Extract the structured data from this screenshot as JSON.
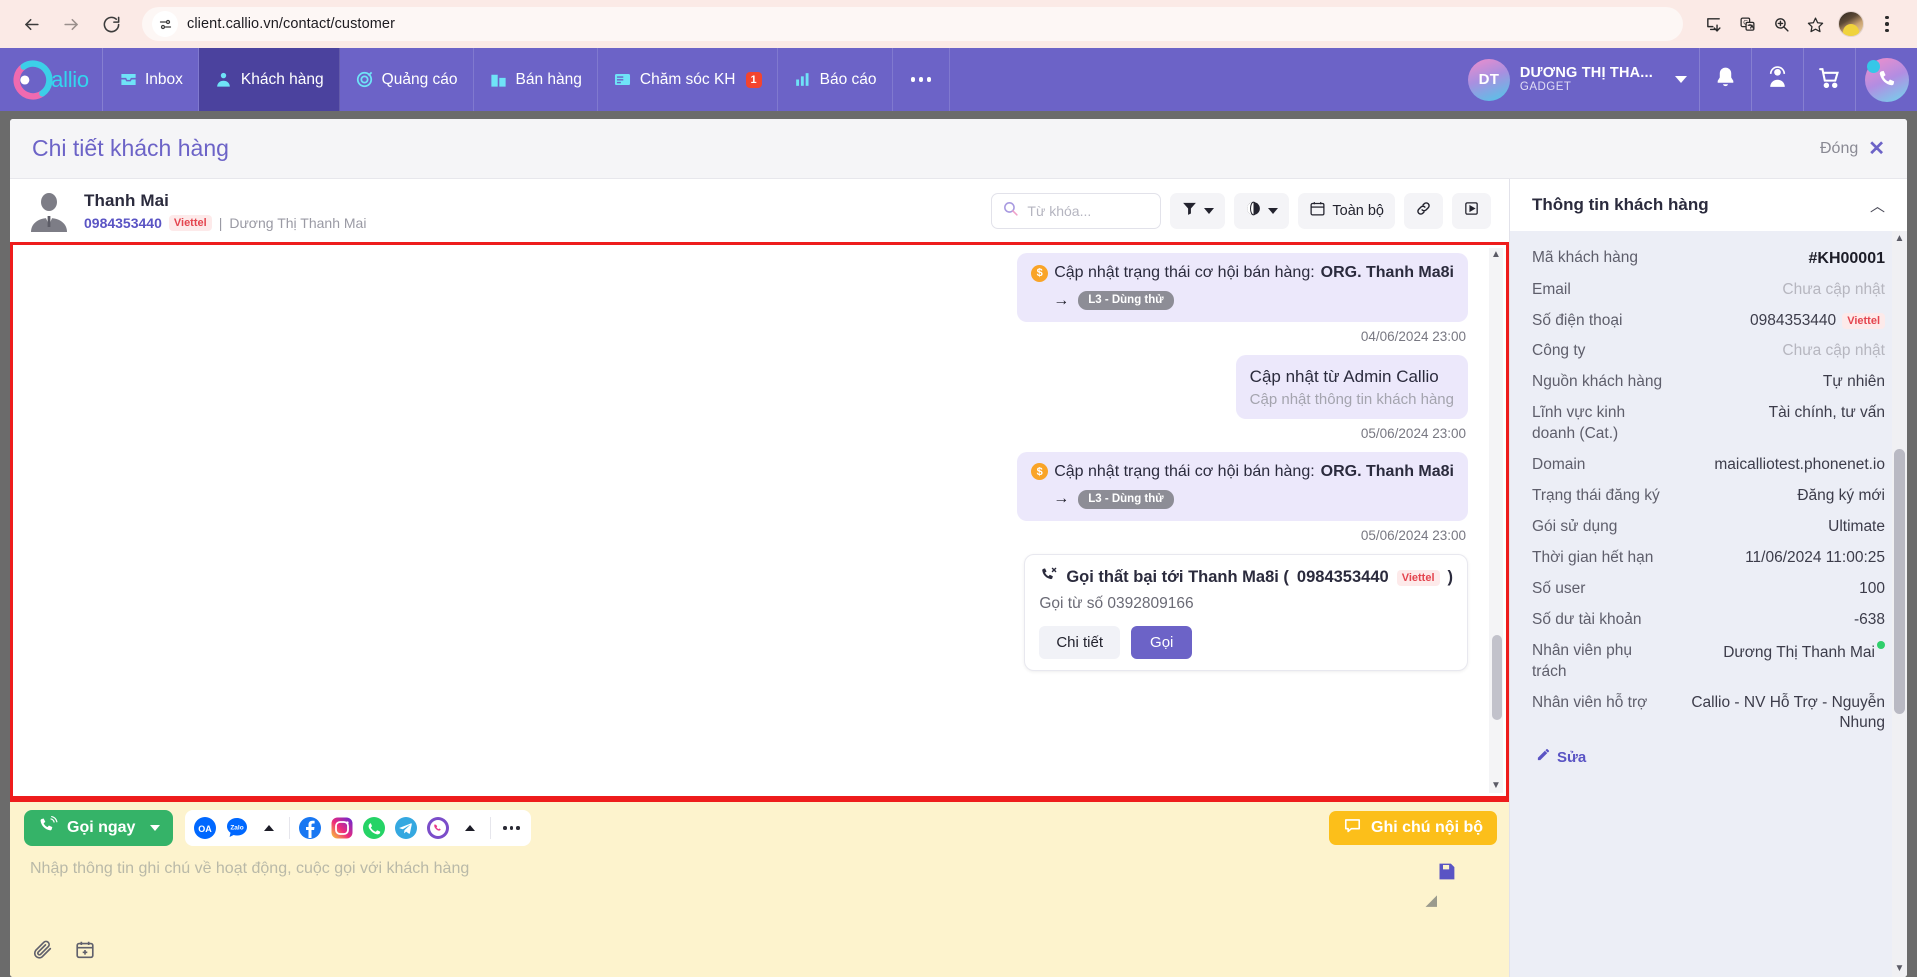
{
  "browser": {
    "url": "client.callio.vn/contact/customer",
    "icons": [
      "back-arrow-icon",
      "forward-arrow-icon",
      "reload-icon",
      "site-settings-icon",
      "install-icon",
      "translate-icon",
      "zoom-icon",
      "bookmark-star-icon",
      "profile-avatar",
      "kebab-menu-icon"
    ]
  },
  "app_header": {
    "brand": "allio",
    "nav": [
      {
        "label": "Inbox",
        "icon": "inbox-icon",
        "active": false,
        "badge": ""
      },
      {
        "label": "Khách hàng",
        "icon": "customers-icon",
        "active": true,
        "badge": ""
      },
      {
        "label": "Quảng cáo",
        "icon": "ads-target-icon",
        "active": false,
        "badge": ""
      },
      {
        "label": "Bán hàng",
        "icon": "sales-building-icon",
        "active": false,
        "badge": ""
      },
      {
        "label": "Chăm sóc KH",
        "icon": "support-ticket-icon",
        "active": false,
        "badge": "1"
      },
      {
        "label": "Báo cáo",
        "icon": "report-chart-icon",
        "active": false,
        "badge": ""
      }
    ],
    "more_label": "...",
    "user": {
      "initials": "DT",
      "name": "DƯƠNG THỊ THA...",
      "org": "GADGET"
    },
    "right_icons": [
      "bell-icon",
      "headset-agent-icon",
      "cart-icon",
      "phone-dialer-icon"
    ],
    "accent_color": "#6c63c7"
  },
  "panel": {
    "title": "Chi tiết khách hàng",
    "close_label": "Đóng",
    "close_x": "✕"
  },
  "contact": {
    "name": "Thanh Mai",
    "phone": "0984353440",
    "carrier": "Viettel",
    "separator": "|",
    "alias": "Dương Thị Thanh Mai"
  },
  "toolbar": {
    "search_placeholder": "Từ khóa...",
    "filter_icon": "funnel-filter-icon",
    "globe_icon": "globe-channel-icon",
    "date_label": "Toàn bộ",
    "date_icon": "calendar-icon",
    "link_icon": "link-chain-icon",
    "video_icon": "video-play-icon"
  },
  "timeline": [
    {
      "type": "deal",
      "icon": "coin-dollar-icon",
      "text": "Cập nhật trạng thái cơ hội bán hàng:",
      "strong": "ORG. Thanh Ma8i",
      "arrow": "→",
      "stage": "L3 - Dùng thử",
      "timestamp": "04/06/2024 23:00"
    },
    {
      "type": "info",
      "title": "Cập nhật từ Admin Callio",
      "subtitle": "Cập nhật thông tin khách hàng",
      "timestamp": "05/06/2024 23:00"
    },
    {
      "type": "deal",
      "icon": "coin-dollar-icon",
      "text": "Cập nhật trạng thái cơ hội bán hàng:",
      "strong": "ORG. Thanh Ma8i",
      "arrow": "→",
      "stage": "L3 - Dùng thử",
      "timestamp": "05/06/2024 23:00"
    },
    {
      "type": "call",
      "icon": "phone-missed-icon",
      "title_prefix": "Gọi thất bại tới Thanh Ma8i (",
      "phone": "0984353440",
      "carrier": "Viettel",
      "title_suffix": ")",
      "subtitle": "Gọi từ số 0392809166",
      "btn_detail": "Chi tiết",
      "btn_call": "Gọi"
    }
  ],
  "composer": {
    "call_now_label": "Gọi ngay",
    "call_now_icon": "phone-ring-icon",
    "channels": [
      "zalo-oa-icon",
      "zalo-icon",
      "up-caret-icon",
      "facebook-icon",
      "instagram-icon",
      "whatsapp-icon",
      "telegram-icon",
      "viber-icon",
      "up-caret-icon",
      "more-dots-icon"
    ],
    "note_label": "Ghi chú nội bộ",
    "note_icon": "chat-bubble-icon",
    "placeholder": "Nhập thông tin ghi chú về hoạt động, cuộc gọi với khách hàng",
    "attach_icon": "paperclip-icon",
    "schedule_icon": "calendar-plus-icon",
    "save_icon": "save-disk-icon"
  },
  "right_panel": {
    "title": "Thông tin khách hàng",
    "collapse_icon": "chevron-up-icon",
    "rows": [
      {
        "key": "Mã khách hàng",
        "value": "#KH00001",
        "style": "code"
      },
      {
        "key": "Email",
        "value": "Chưa cập nhật",
        "style": "muted"
      },
      {
        "key": "Số điện thoại",
        "value": "0984353440",
        "carrier": "Viettel",
        "style": "normal"
      },
      {
        "key": "Công ty",
        "value": "Chưa cập nhật",
        "style": "muted"
      },
      {
        "key": "Nguồn khách hàng",
        "value": "Tự nhiên",
        "style": "normal"
      },
      {
        "key": "Lĩnh vực kinh doanh (Cat.)",
        "value": "Tài chính, tư vấn",
        "style": "normal"
      },
      {
        "key": "Domain",
        "value": "maicalliotest.phonenet.io",
        "style": "normal"
      },
      {
        "key": "Trạng thái đăng ký",
        "value": "Đăng ký mới",
        "style": "normal"
      },
      {
        "key": "Gói sử dụng",
        "value": "Ultimate",
        "style": "normal"
      },
      {
        "key": "Thời gian hết hạn",
        "value": "11/06/2024 11:00:25",
        "style": "normal"
      },
      {
        "key": "Số user",
        "value": "100",
        "style": "normal"
      },
      {
        "key": "Số dư tài khoản",
        "value": "-638",
        "style": "normal"
      },
      {
        "key": "Nhân viên phụ trách",
        "value": "Dương Thị Thanh Mai",
        "online": true,
        "style": "normal"
      },
      {
        "key": "Nhân viên hỗ trợ",
        "value": "Callio - NV Hỗ Trợ - Nguyễn Nhung",
        "style": "normal"
      }
    ],
    "edit_label": "Sửa",
    "edit_icon": "pencil-icon"
  }
}
